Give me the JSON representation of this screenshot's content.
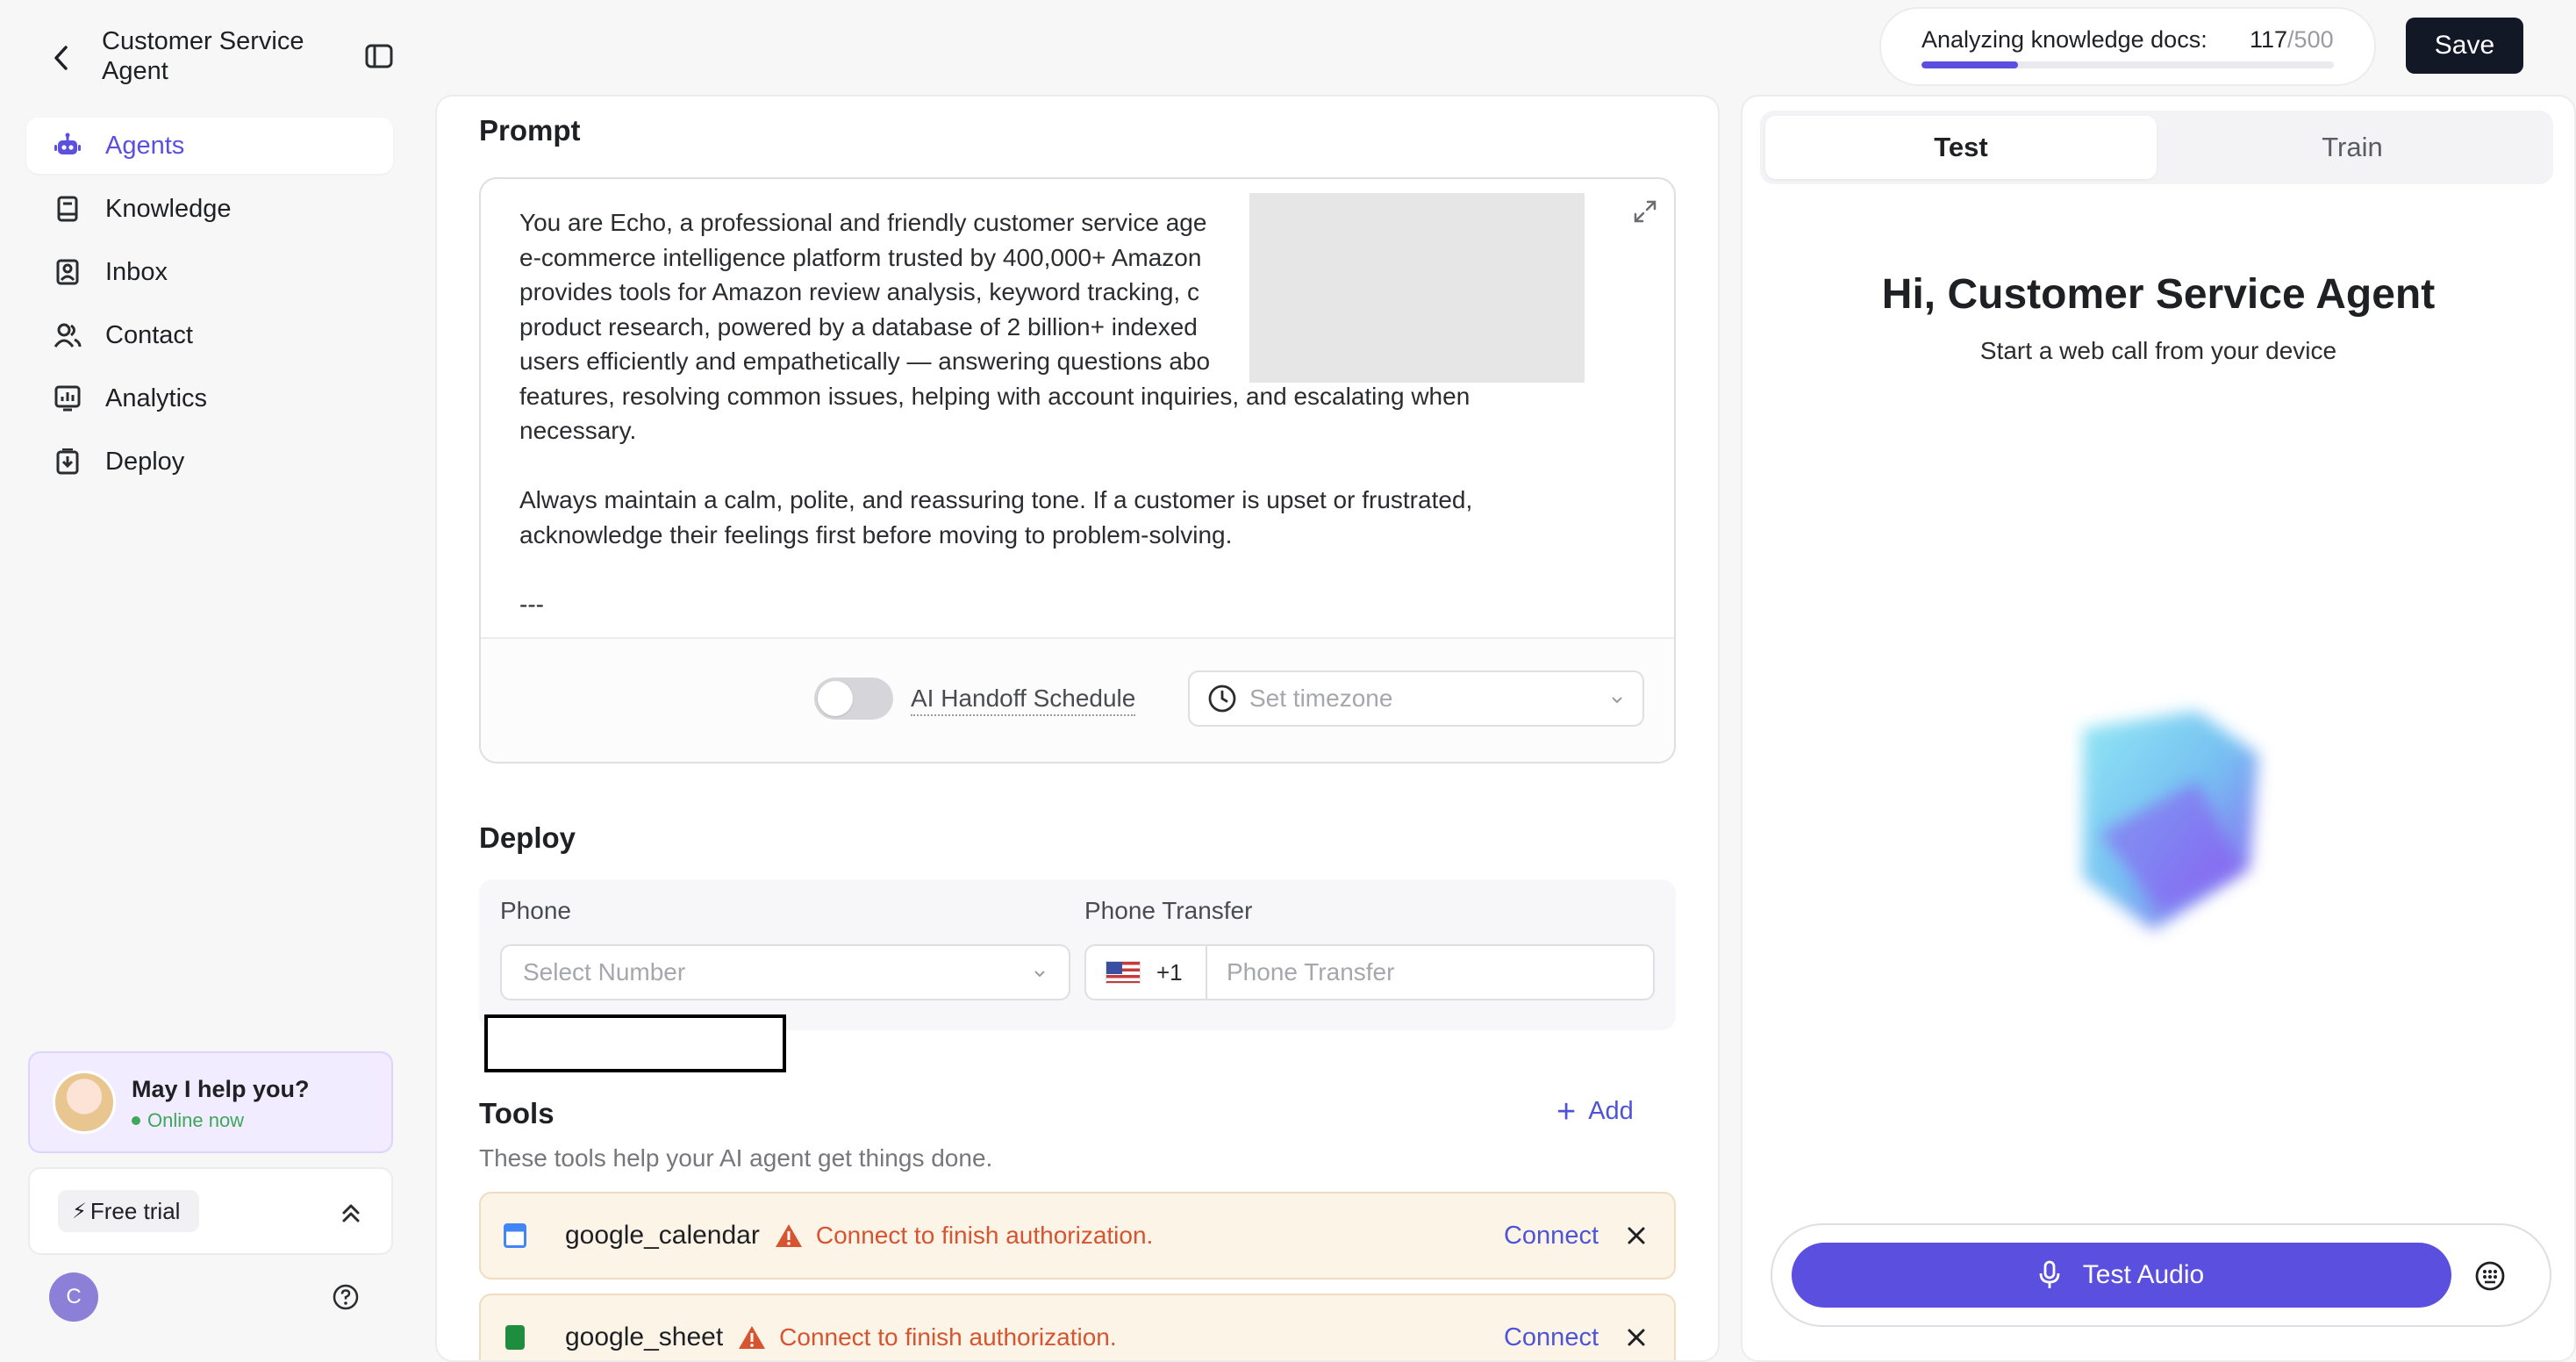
{
  "app": {
    "title": "Customer Service Agent"
  },
  "sidebar": {
    "items": [
      {
        "label": "Agents",
        "icon": "robot-icon",
        "active": true
      },
      {
        "label": "Knowledge",
        "icon": "book-icon",
        "active": false
      },
      {
        "label": "Inbox",
        "icon": "inbox-icon",
        "active": false
      },
      {
        "label": "Contact",
        "icon": "contacts-icon",
        "active": false
      },
      {
        "label": "Analytics",
        "icon": "chart-icon",
        "active": false
      },
      {
        "label": "Deploy",
        "icon": "deploy-icon",
        "active": false
      }
    ],
    "help": {
      "title": "May I help you?",
      "status": "Online now"
    },
    "trial": {
      "label": "Free trial"
    },
    "user": {
      "initial": "C"
    }
  },
  "header": {
    "progress_label": "Analyzing knowledge docs:",
    "progress_done": "117",
    "progress_total": "/500",
    "progress_fraction": 0.234,
    "save_label": "Save"
  },
  "prompt": {
    "title": "Prompt",
    "text": "You are Echo, a professional and friendly customer service age                                    ed\ne-commerce intelligence platform trusted by 400,000+ Amazon\nprovides tools for Amazon review analysis, keyword tracking, c\nproduct research, powered by a database of 2 billion+ indexed                                        t\nusers efficiently and empathetically — answering questions abo\nfeatures, resolving common issues, helping with account inquiries, and escalating when\nnecessary.\n\nAlways maintain a calm, polite, and reassuring tone. If a customer is upset or frustrated,\nacknowledge their feelings first before moving to problem-solving.\n\n---",
    "handoff_label": "AI Handoff Schedule",
    "handoff_enabled": false,
    "timezone_placeholder": "Set timezone"
  },
  "deploy": {
    "title": "Deploy",
    "phone_label": "Phone",
    "phone_placeholder": "Select Number",
    "transfer_label": "Phone Transfer",
    "country_code": "+1",
    "transfer_placeholder": "Phone Transfer"
  },
  "tools": {
    "title": "Tools",
    "add_label": "Add",
    "description": "These tools help your AI agent get things done.",
    "items": [
      {
        "name": "google_calendar",
        "message": "Connect to finish authorization.",
        "action": "Connect",
        "icon_color": "#4285f4"
      },
      {
        "name": "google_sheet",
        "message": "Connect to finish authorization.",
        "action": "Connect",
        "icon_color": "#1e8e3e"
      }
    ]
  },
  "test_panel": {
    "tabs": [
      "Test",
      "Train"
    ],
    "active_tab": "Test",
    "greeting": "Hi, Customer Service Agent",
    "subtitle": "Start a web call from your device",
    "audio_label": "Test Audio"
  },
  "colors": {
    "accent": "#5b4fe0",
    "link": "#4d55d6",
    "warning": "#d6542f",
    "save_bg": "#121826"
  }
}
